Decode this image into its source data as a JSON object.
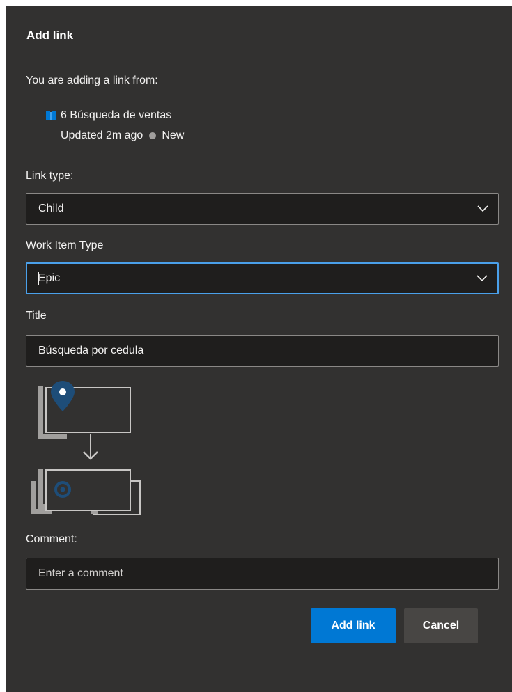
{
  "dialog": {
    "title": "Add link",
    "from_label": "You are adding a link from:"
  },
  "source_item": {
    "icon": "book-icon",
    "title": "6 Búsqueda de ventas",
    "updated": "Updated 2m ago",
    "state": "New",
    "icon_color": "#0078d4",
    "state_color": "#a19f9d"
  },
  "link_type": {
    "label": "Link type:",
    "value": "Child"
  },
  "work_item_type": {
    "label": "Work Item Type",
    "value": "Epic"
  },
  "title_field": {
    "label": "Title",
    "value": "Búsqueda por cedula"
  },
  "comment": {
    "label": "Comment:",
    "placeholder": "Enter a comment"
  },
  "buttons": {
    "add_link": "Add link",
    "cancel": "Cancel"
  },
  "colors": {
    "background": "#323130",
    "input_background": "#1f1e1d",
    "primary": "#0078d4",
    "focus": "#4aa0ea"
  }
}
